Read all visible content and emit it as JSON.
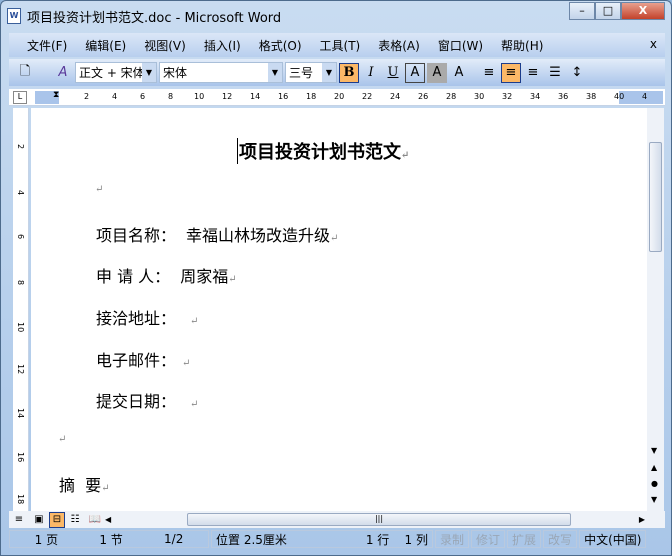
{
  "window": {
    "title": "项目投资计划书范文.doc - Microsoft Word",
    "icon": "word-doc-icon",
    "minimize": "–",
    "maximize": "□",
    "close": "X"
  },
  "menu": [
    "文件(F)",
    "编辑(E)",
    "视图(V)",
    "插入(I)",
    "格式(O)",
    "工具(T)",
    "表格(A)",
    "窗口(W)",
    "帮助(H)"
  ],
  "menu_close": "x",
  "toolbar": {
    "style": "正文 + 宋体",
    "font": "宋体",
    "size": "三号",
    "bold": "B",
    "italic": "I",
    "underline": "U",
    "char_border": "A",
    "char_shade": "A",
    "scale": "A"
  },
  "ruler": [
    "2",
    "4",
    "6",
    "8",
    "10",
    "12",
    "14",
    "16",
    "18",
    "20",
    "22",
    "24",
    "26",
    "28",
    "30",
    "32",
    "34",
    "36",
    "38",
    "40",
    "4"
  ],
  "vruler": [
    "2",
    "4",
    "6",
    "8",
    "10",
    "12",
    "14",
    "16",
    "18"
  ],
  "document": {
    "title": "项目投资计划书范文",
    "fields": [
      {
        "label": "项目名称：",
        "value": "幸福山林场改造升级"
      },
      {
        "label": "申 请 人：",
        "value": "周家福"
      },
      {
        "label": "接洽地址：",
        "value": ""
      },
      {
        "label": "电子邮件：",
        "value": ""
      },
      {
        "label": "提交日期：",
        "value": ""
      }
    ],
    "heading": "摘  要",
    "para_mark": "↵"
  },
  "status": {
    "page": "1 页",
    "section": "1 节",
    "pages": "1/2",
    "position": "位置 2.5厘米",
    "line": "1 行",
    "col": "1 列",
    "rec": "录制",
    "trk": "修订",
    "ext": "扩展",
    "ovr": "改写",
    "lang": "中文(中国)"
  }
}
